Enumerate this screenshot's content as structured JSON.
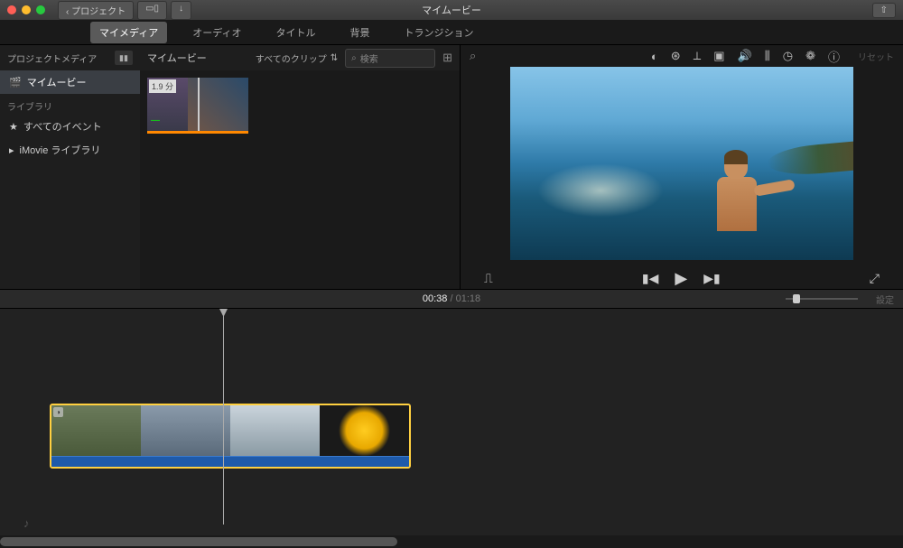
{
  "titlebar": {
    "title": "マイムービー",
    "back": "プロジェクト"
  },
  "tabs": {
    "mymedia": "マイメディア",
    "audio": "オーディオ",
    "titles": "タイトル",
    "bg": "背景",
    "trans": "トランジション"
  },
  "sidebar": {
    "hdr": "プロジェクトメディア",
    "movie": "マイムービー",
    "libcat": "ライブラリ",
    "allEvents": "すべてのイベント",
    "imLib": "iMovie ライブラリ"
  },
  "browser": {
    "title": "マイムービー",
    "clips": "すべてのクリップ",
    "search": "検索",
    "dur": "1.9 分"
  },
  "preview": {
    "reset": "リセット"
  },
  "time": {
    "cur": "00:38",
    "sep": " / ",
    "dur": "01:18",
    "zoom": "設定"
  }
}
